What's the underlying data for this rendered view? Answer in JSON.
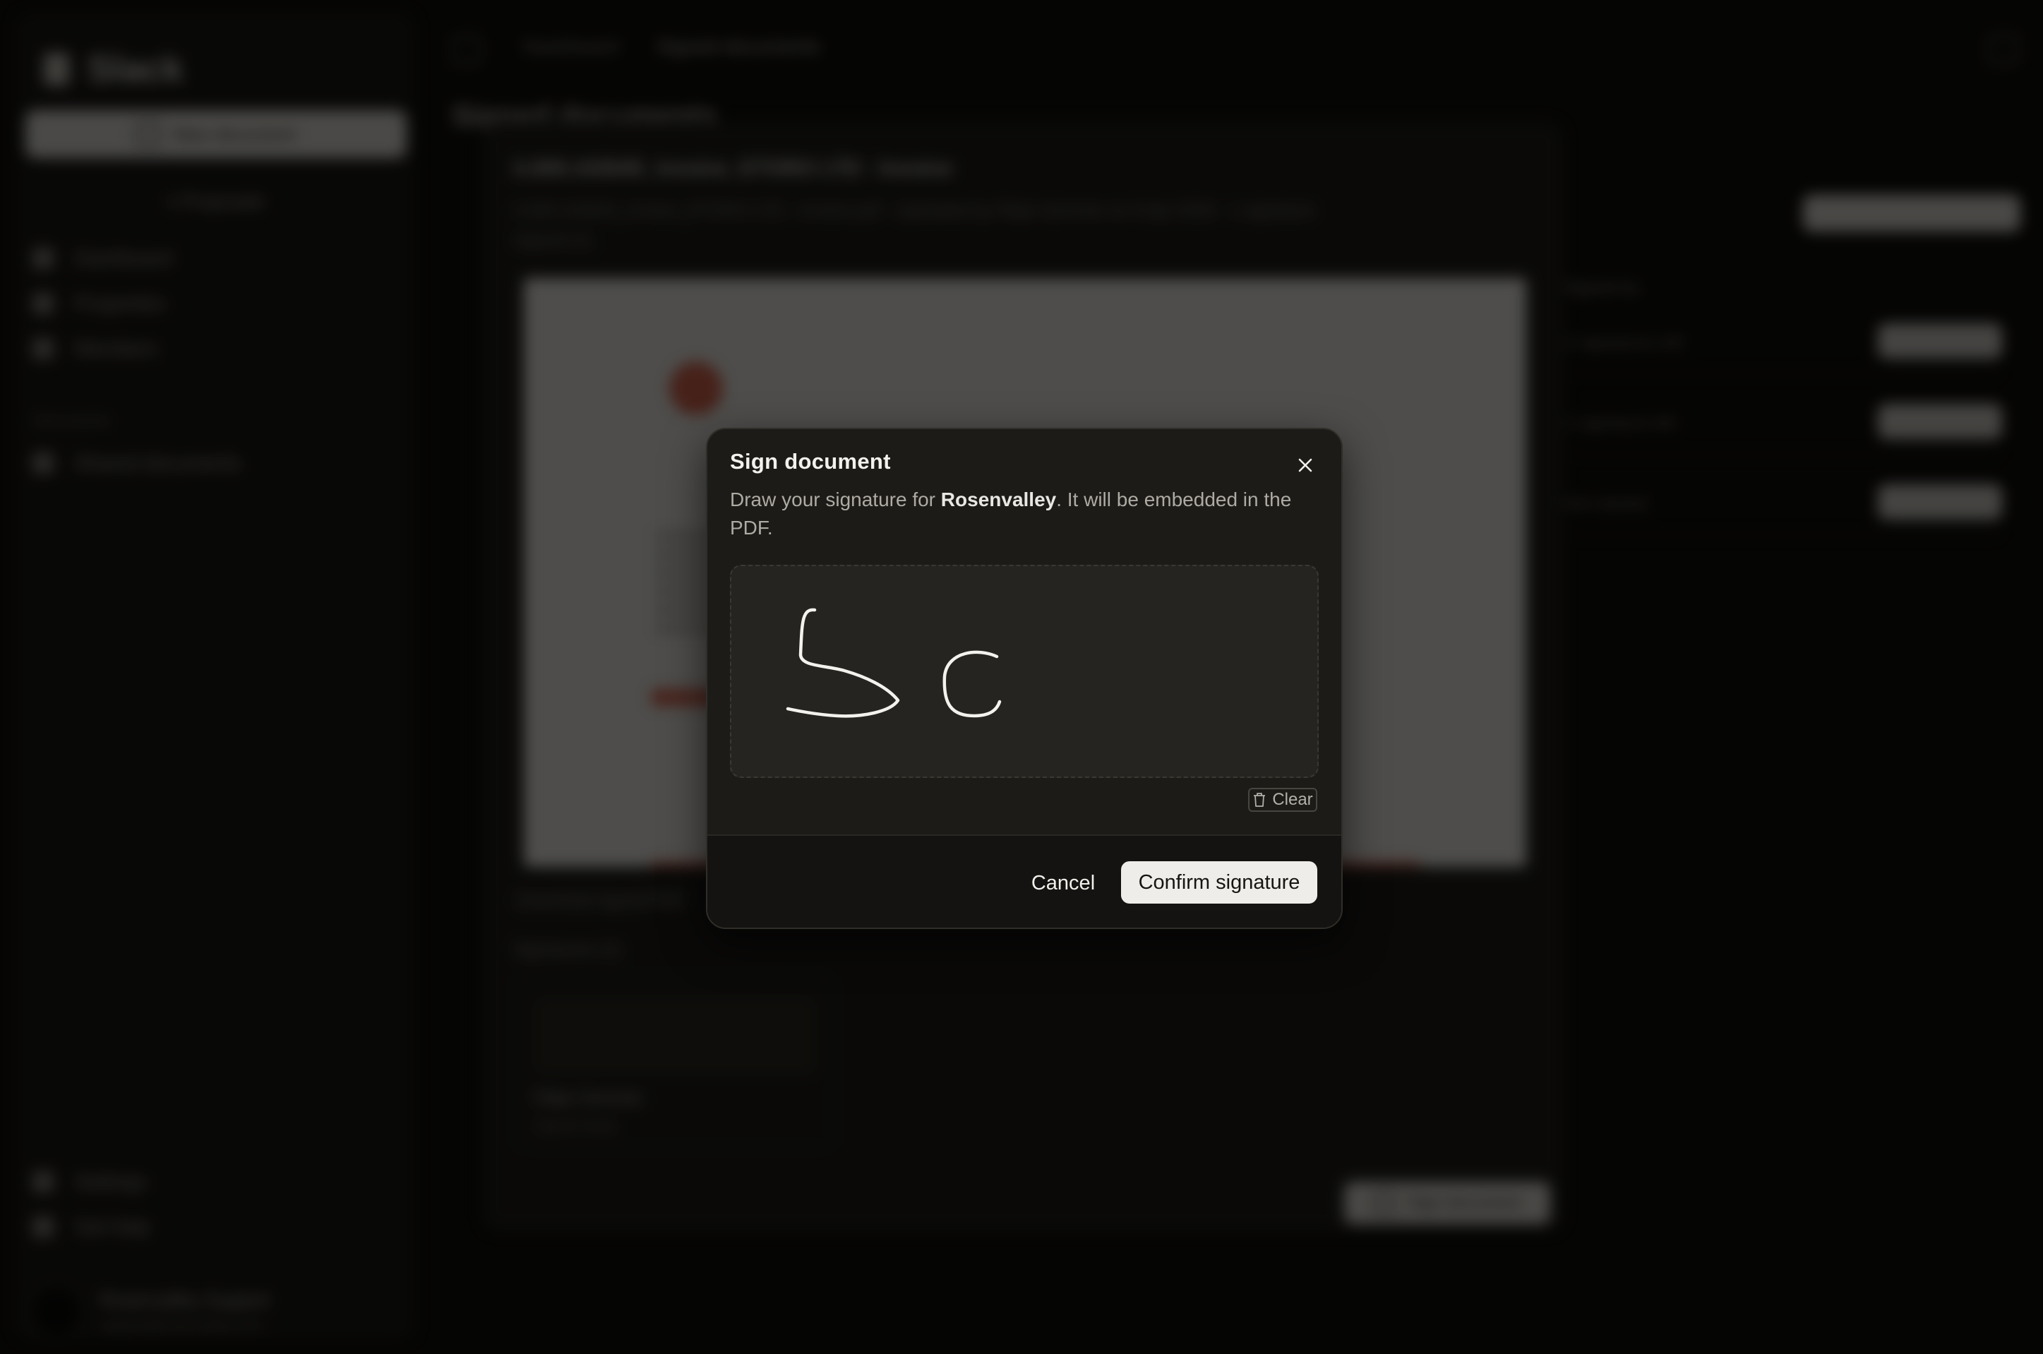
{
  "app": {
    "name": "Slack"
  },
  "sidebar": {
    "new_document": "New document",
    "proposals": "1 Proposals",
    "items": [
      {
        "label": "Dashboard"
      },
      {
        "label": "Properties"
      },
      {
        "label": "Members"
      }
    ],
    "section": "Documents",
    "doc_items": [
      {
        "label": "Shared documents"
      }
    ],
    "bottom_items": [
      {
        "label": "Settings"
      },
      {
        "label": "Get help"
      }
    ],
    "user": {
      "initial": "N",
      "name": "Rosenvalley Support",
      "email": "support@rosenvalley.com"
    }
  },
  "topbar": {
    "crumb_root": "Dashboard",
    "crumb_current": "Signed documents"
  },
  "page": {
    "title": "Signed documents"
  },
  "panel": {
    "title": "Ii.000.103045_invoice_ETORO LTD - Invoice",
    "meta": "Ii.000.103045_invoice_ETORO LTD - Invoice.pdf · Uploaded by Filipe Sommer on 9 Apr 2026 · 1 signature",
    "meta2": "Signed (1)",
    "download": "Download signed PDF",
    "signatures_label": "Signatures (1)",
    "signer_name": "Filipe Sommer",
    "signer_date": "Signed today",
    "sign_button": "Sign document"
  },
  "right": {
    "head": "Signed by",
    "rows": [
      {
        "label": "2 signatures left"
      },
      {
        "label": "1 signature left"
      },
      {
        "label": "Not started"
      }
    ]
  },
  "modal": {
    "title": "Sign document",
    "desc_before": "Draw your signature for ",
    "desc_company": "Rosenvalley",
    "desc_after": ". It will be embedded in the PDF.",
    "clear": "Clear",
    "cancel": "Cancel",
    "confirm": "Confirm signature"
  },
  "colors": {
    "accent": "#d3614b",
    "background": "#0b0a08",
    "modal": "#1c1b18"
  },
  "icons": {
    "close": "close-icon",
    "trash": "trash-icon"
  }
}
